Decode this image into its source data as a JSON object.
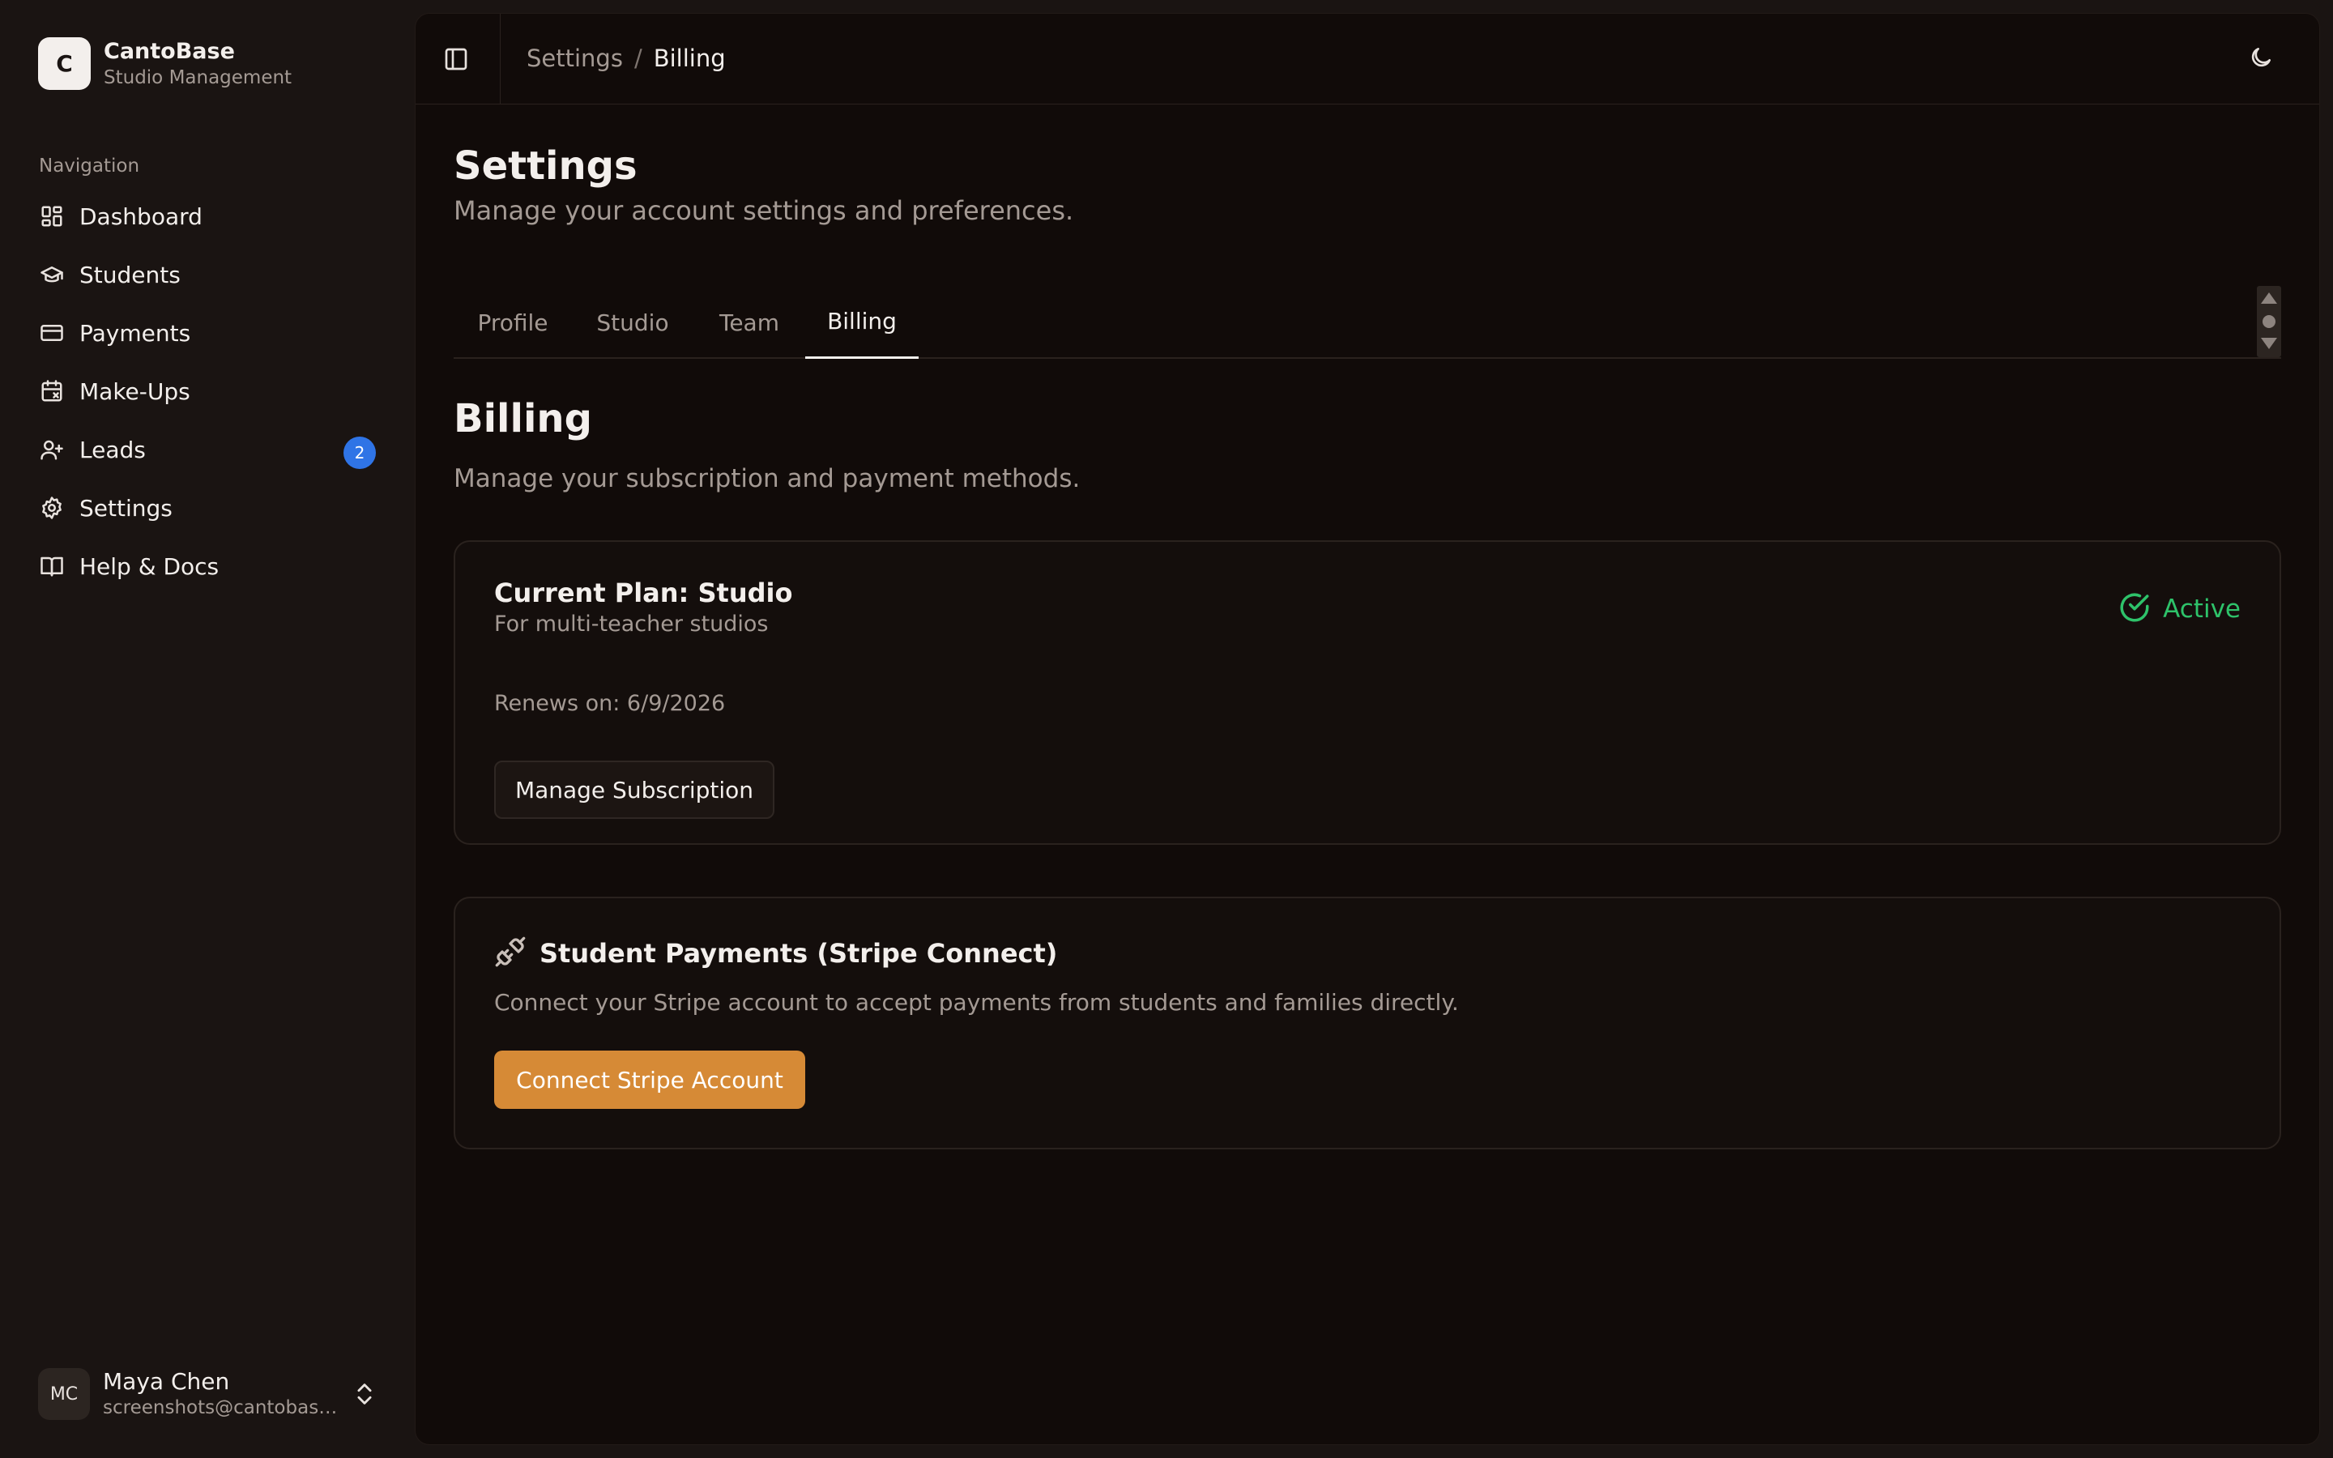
{
  "brand": {
    "logo_letter": "C",
    "name": "CantoBase",
    "subtitle": "Studio Management"
  },
  "sidebar": {
    "heading": "Navigation",
    "items": [
      {
        "label": "Dashboard",
        "icon": "dashboard-icon"
      },
      {
        "label": "Students",
        "icon": "graduation-cap-icon"
      },
      {
        "label": "Payments",
        "icon": "credit-card-icon"
      },
      {
        "label": "Make-Ups",
        "icon": "calendar-x-icon"
      },
      {
        "label": "Leads",
        "icon": "user-plus-icon",
        "badge": "2"
      },
      {
        "label": "Settings",
        "icon": "gear-icon"
      },
      {
        "label": "Help & Docs",
        "icon": "book-icon"
      }
    ]
  },
  "user": {
    "initials": "MC",
    "name": "Maya Chen",
    "email": "screenshots@cantobase.com"
  },
  "topbar": {
    "breadcrumb_parent": "Settings",
    "breadcrumb_separator": "/",
    "breadcrumb_current": "Billing"
  },
  "page": {
    "title": "Settings",
    "subtitle": "Manage your account settings and preferences."
  },
  "tabs": [
    {
      "label": "Profile"
    },
    {
      "label": "Studio"
    },
    {
      "label": "Team"
    },
    {
      "label": "Billing",
      "active": true
    }
  ],
  "billing": {
    "title": "Billing",
    "subtitle": "Manage your subscription and payment methods.",
    "plan": {
      "title": "Current Plan: Studio",
      "description": "For multi-teacher studios",
      "status": "Active",
      "renews": "Renews on: 6/9/2026",
      "button": "Manage Subscription"
    },
    "stripe": {
      "title": "Student Payments (Stripe Connect)",
      "description": "Connect your Stripe account to accept payments from students and families directly.",
      "button": "Connect Stripe Account"
    }
  },
  "colors": {
    "background": "#1a1412",
    "panel": "#110b09",
    "accent_orange": "#d68a36",
    "status_green": "#2ec26a",
    "badge_blue": "#2f74e6"
  }
}
